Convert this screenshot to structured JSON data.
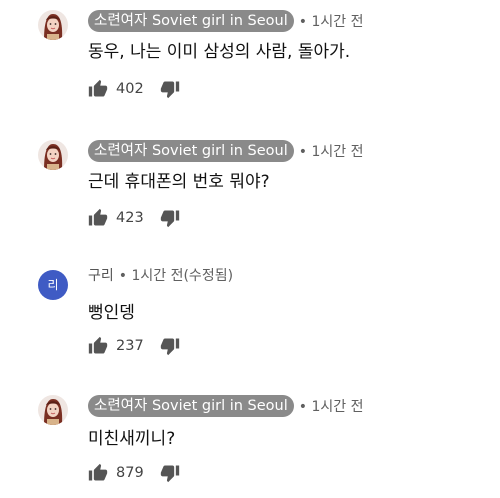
{
  "comments": [
    {
      "author": "소련여자 Soviet girl in Seoul",
      "time": "• 1시간 전",
      "text": "동우, 나는 이미 삼성의 사람, 돌아가.",
      "likes": "402",
      "avatar_icon": "profile-photo"
    },
    {
      "author": "소련여자 Soviet girl in Seoul",
      "time": "• 1시간 전",
      "text": "근데 휴대폰의 번호 뭐야?",
      "likes": "423",
      "avatar_icon": "profile-photo"
    },
    {
      "author": "구리",
      "time": "• 1시간 전(수정됨)",
      "text": "뻥인뎅",
      "likes": "237",
      "avatar_letter": "리",
      "avatar_color": "#3f5bc4"
    },
    {
      "author": "소련여자 Soviet girl in Seoul",
      "time": "• 1시간 전",
      "text": "미친새끼니?",
      "likes": "879",
      "avatar_icon": "profile-photo"
    }
  ],
  "icons": {
    "like": "thumbs-up-icon",
    "dislike": "thumbs-down-icon"
  }
}
